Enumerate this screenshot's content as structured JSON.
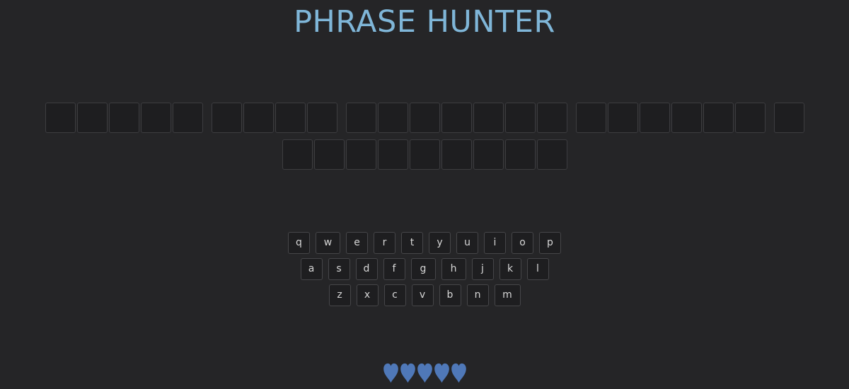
{
  "title": "PHRASE HUNTER",
  "phrase": {
    "rows": [
      [
        5,
        4,
        7,
        6,
        1
      ],
      [
        9
      ]
    ]
  },
  "keyboard": {
    "rows": [
      [
        "q",
        "w",
        "e",
        "r",
        "t",
        "y",
        "u",
        "i",
        "o",
        "p"
      ],
      [
        "a",
        "s",
        "d",
        "f",
        "g",
        "h",
        "j",
        "k",
        "l"
      ],
      [
        "z",
        "x",
        "c",
        "v",
        "b",
        "n",
        "m"
      ]
    ]
  },
  "lives": {
    "remaining": 5,
    "total": 5,
    "icon": "heart-icon",
    "color": "#4f78b8"
  },
  "colors": {
    "background": "#252527",
    "title": "#7fb6d8",
    "tile": "#1e1e20",
    "tile_border": "#3d3d40",
    "key_text": "#d6d6d6"
  }
}
